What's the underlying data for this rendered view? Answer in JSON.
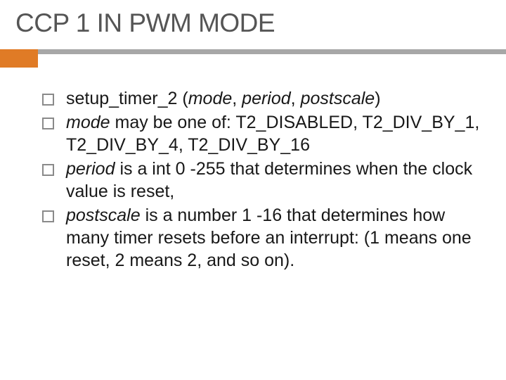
{
  "title": "CCP 1 IN PWM MODE",
  "b1_fn": "setup_timer_2",
  "b1_open": " (",
  "b1_p1": "mode",
  "b1_c1": ", ",
  "b1_p2": "period",
  "b1_c2": ", ",
  "b1_p3": "postscale",
  "b1_close": ")",
  "b2_lead": "mode",
  "b2_rest": " may be one of: T2_DISABLED, T2_DIV_BY_1, T2_DIV_BY_4, T2_DIV_BY_16",
  "b3_lead": "period",
  "b3_rest": " is a int 0 -255 that determines when the clock value is reset,",
  "b4_lead": "postscale",
  "b4_rest": " is a number 1 -16 that determines how many timer resets before an interrupt: (1 means one reset, 2 means 2, and so on)."
}
